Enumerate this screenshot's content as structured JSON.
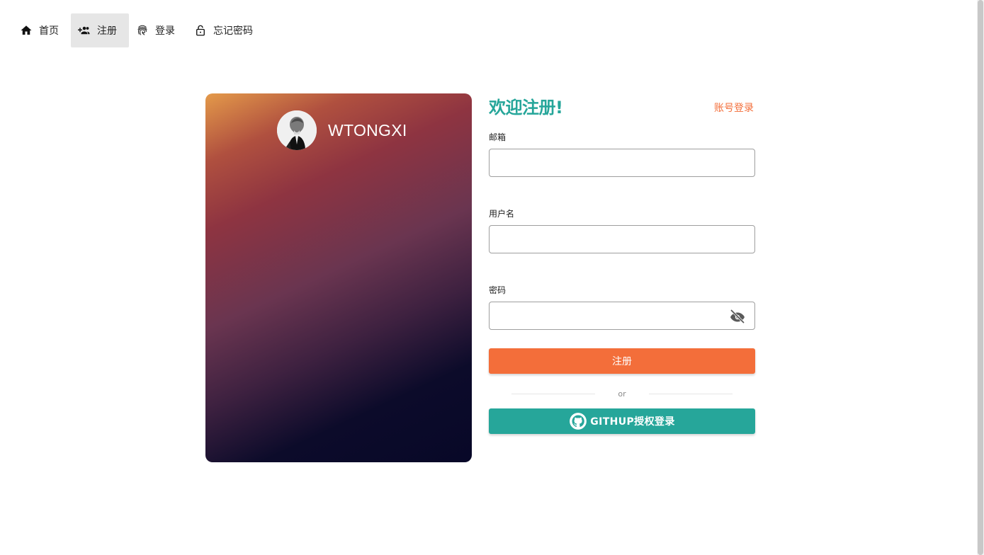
{
  "nav": {
    "items": [
      {
        "label": "首页",
        "icon": "home-icon"
      },
      {
        "label": "注册",
        "icon": "add-user-icon",
        "active": true
      },
      {
        "label": "登录",
        "icon": "fingerprint-icon"
      },
      {
        "label": "忘记密码",
        "icon": "lock-icon"
      }
    ]
  },
  "card": {
    "profile_name": "WTONGXI"
  },
  "form": {
    "title": "欢迎注册!",
    "switch_link": "账号登录",
    "email_label": "邮箱",
    "email_value": "",
    "username_label": "用户名",
    "username_value": "",
    "password_label": "密码",
    "password_value": "",
    "register_button": "注册",
    "divider_text": "or",
    "github_button": "GITHUP授权登录"
  },
  "colors": {
    "accent_teal": "#26a69a",
    "accent_orange": "#f36e3a"
  }
}
